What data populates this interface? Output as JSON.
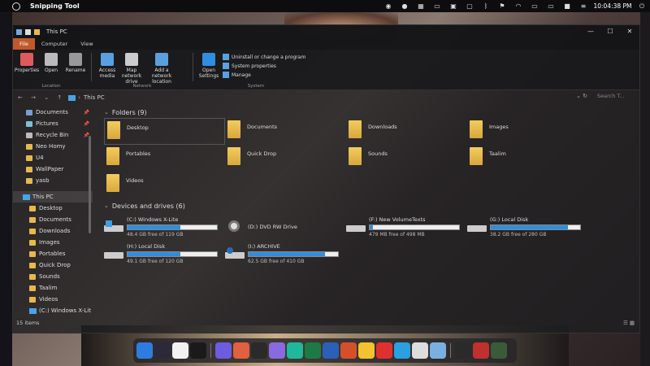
{
  "topbar": {
    "app_name": "Snipping Tool",
    "clock": "10:04:38 PM"
  },
  "window": {
    "title": "This PC",
    "controls": {
      "minimize": "—",
      "maximize": "☐",
      "close": "✕"
    },
    "tabs": [
      "File",
      "Computer",
      "View"
    ]
  },
  "ribbon": {
    "location": {
      "label": "Location",
      "items": [
        {
          "label": "Properties",
          "icon": "properties-icon",
          "color": "#e05a5a"
        },
        {
          "label": "Open",
          "icon": "open-icon",
          "color": "#bbbbbb"
        },
        {
          "label": "Rename",
          "icon": "rename-icon",
          "color": "#999999"
        }
      ]
    },
    "network": {
      "label": "Network",
      "items": [
        {
          "label": "Access media",
          "icon": "access-media-icon",
          "color": "#5aa0e0"
        },
        {
          "label": "Map network drive",
          "icon": "map-drive-icon",
          "color": "#cccccc"
        },
        {
          "label": "Add a network location",
          "icon": "network-location-icon",
          "color": "#5aa0e0"
        }
      ]
    },
    "system": {
      "label": "System",
      "open_settings": "Open Settings",
      "list": [
        "Uninstall or change a program",
        "System properties",
        "Manage"
      ]
    }
  },
  "address": {
    "crumb": "This PC",
    "search_placeholder": "Search T..."
  },
  "navpane": {
    "quick": [
      {
        "label": "Documents",
        "pinned": true
      },
      {
        "label": "Pictures",
        "pinned": true
      },
      {
        "label": "Recycle Bin",
        "pinned": true
      },
      {
        "label": "Neo Homy"
      },
      {
        "label": "U4"
      },
      {
        "label": "WallPaper"
      },
      {
        "label": "yasb"
      }
    ],
    "thispc": "This PC",
    "children": [
      "Desktop",
      "Documents",
      "Downloads",
      "Images",
      "Portables",
      "Quick Drop",
      "Sounds",
      "Taalim",
      "Videos",
      "(C:) Windows X-Lit"
    ]
  },
  "folders": {
    "heading": "Folders (9)",
    "items": [
      "Desktop",
      "Documents",
      "Downloads",
      "Images",
      "Portables",
      "Quick Drop",
      "Sounds",
      "Taalim",
      "Videos"
    ]
  },
  "drives": {
    "heading": "Devices and drives (6)",
    "items": [
      {
        "name": "(C:) Windows X-Lite",
        "free": "48.4 GB free of 119 GB",
        "used_fraction": 0.59,
        "kind": "windows"
      },
      {
        "name": "(D:) DVD RW Drive",
        "free": "",
        "used_fraction": null,
        "kind": "dvd"
      },
      {
        "name": "(F:) New VolumeTexts",
        "free": "479 MB free of 498 MB",
        "used_fraction": 0.04,
        "kind": "hdd"
      },
      {
        "name": "(G:) Local Disk",
        "free": "38.2 GB free of 280 GB",
        "used_fraction": 0.86,
        "kind": "hdd"
      },
      {
        "name": "(H:) Local Disk",
        "free": "49.1 GB free of 120 GB",
        "used_fraction": 0.59,
        "kind": "hdd"
      },
      {
        "name": "(I:) ARCHIVE",
        "free": "62.5 GB free of 410 GB",
        "used_fraction": 0.85,
        "kind": "archive"
      }
    ]
  },
  "status": {
    "count": "15 items"
  },
  "dock": {
    "apps": [
      {
        "name": "finder-icon",
        "color": "#2f7ce0"
      },
      {
        "name": "launchpad-icon",
        "color": "#2a2a3a"
      },
      {
        "name": "calendar-icon",
        "color": "#f2f2f2"
      },
      {
        "name": "clock-icon",
        "color": "#1a1a1a"
      },
      {
        "name": "sep"
      },
      {
        "name": "ai-app-icon",
        "color": "#6b5ce0"
      },
      {
        "name": "spark-icon",
        "color": "#e06040"
      },
      {
        "name": "chatgpt-icon",
        "color": "#2a2a2a"
      },
      {
        "name": "copilot-icon",
        "color": "#8a6ae0"
      },
      {
        "name": "teal-app-icon",
        "color": "#1fb89a"
      },
      {
        "name": "excel-icon",
        "color": "#1d7a45"
      },
      {
        "name": "word-icon",
        "color": "#2b5fb8"
      },
      {
        "name": "powerpoint-icon",
        "color": "#d4502a"
      },
      {
        "name": "drive-icon",
        "color": "#f2c230"
      },
      {
        "name": "red-app-icon",
        "color": "#e03030"
      },
      {
        "name": "telegram-icon",
        "color": "#2aa0e0"
      },
      {
        "name": "chrome-icon",
        "color": "#dddddd"
      },
      {
        "name": "store-icon",
        "color": "#7ab0e0"
      },
      {
        "name": "sep"
      },
      {
        "name": "photos-icon",
        "color": "#2a2a2a"
      },
      {
        "name": "pdf-icon",
        "color": "#c03030"
      },
      {
        "name": "recycle-icon",
        "color": "#3a5a3a"
      }
    ]
  }
}
